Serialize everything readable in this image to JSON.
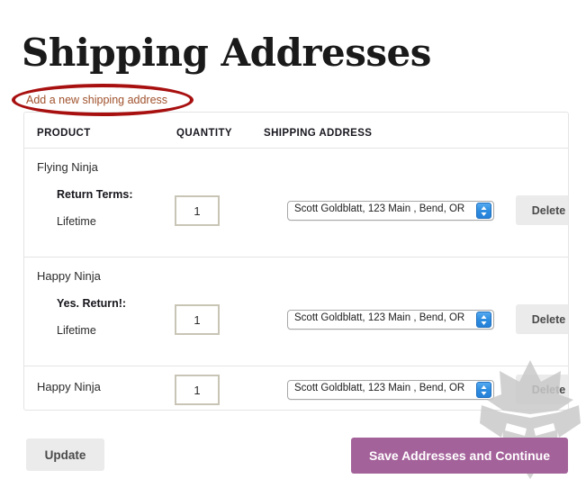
{
  "page": {
    "title": "Shipping Addresses"
  },
  "add_address": {
    "link_label": "Add a new shipping address",
    "link_color": "#a0522d",
    "annotation_color": "#a81010"
  },
  "table": {
    "headers": {
      "product": "PRODUCT",
      "quantity": "QUANTITY",
      "address": "SHIPPING ADDRESS"
    },
    "rows": [
      {
        "product": "Flying Ninja",
        "meta_label": "Return Terms:",
        "meta_value": "Lifetime",
        "quantity": "1",
        "address_selected": "Scott Goldblatt, 123 Main , Bend, OR",
        "delete_label": "Delete"
      },
      {
        "product": "Happy Ninja",
        "meta_label": "Yes. Return!:",
        "meta_value": "Lifetime",
        "quantity": "1",
        "address_selected": "Scott Goldblatt, 123 Main , Bend, OR",
        "delete_label": "Delete"
      },
      {
        "product": "Happy Ninja",
        "meta_label": "",
        "meta_value": "",
        "quantity": "1",
        "address_selected": "Scott Goldblatt, 123 Main , Bend, OR",
        "delete_label": "Delete"
      }
    ]
  },
  "footer": {
    "update_label": "Update",
    "save_label": "Save Addresses and Continue",
    "save_color": "#a4629a"
  },
  "watermark": {
    "name": "ninja-mask-logo"
  }
}
